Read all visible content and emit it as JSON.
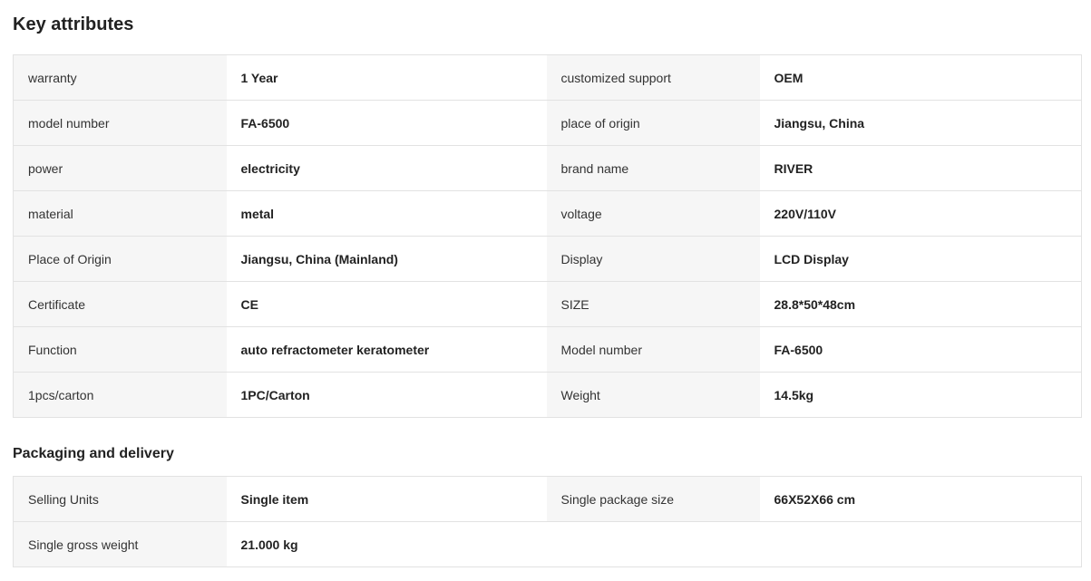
{
  "key_attributes": {
    "title": "Key attributes",
    "rows": [
      [
        {
          "label": "warranty",
          "value": "1 Year"
        },
        {
          "label": "customized support",
          "value": "OEM"
        }
      ],
      [
        {
          "label": "model number",
          "value": "FA-6500"
        },
        {
          "label": "place of origin",
          "value": "Jiangsu, China"
        }
      ],
      [
        {
          "label": "power",
          "value": "electricity"
        },
        {
          "label": "brand name",
          "value": "RIVER"
        }
      ],
      [
        {
          "label": "material",
          "value": "metal"
        },
        {
          "label": "voltage",
          "value": "220V/110V"
        }
      ],
      [
        {
          "label": "Place of Origin",
          "value": "Jiangsu, China (Mainland)"
        },
        {
          "label": "Display",
          "value": "LCD Display"
        }
      ],
      [
        {
          "label": "Certificate",
          "value": "CE"
        },
        {
          "label": "SIZE",
          "value": "28.8*50*48cm"
        }
      ],
      [
        {
          "label": "Function",
          "value": "auto refractometer keratometer"
        },
        {
          "label": "Model number",
          "value": "FA-6500"
        }
      ],
      [
        {
          "label": "1pcs/carton",
          "value": "1PC/Carton"
        },
        {
          "label": "Weight",
          "value": "14.5kg"
        }
      ]
    ]
  },
  "packaging": {
    "title": "Packaging and delivery",
    "rows": [
      [
        {
          "label": "Selling Units",
          "value": "Single item"
        },
        {
          "label": "Single package size",
          "value": "66X52X66 cm"
        }
      ],
      [
        {
          "label": "Single gross weight",
          "value": "21.000 kg"
        },
        null
      ]
    ]
  }
}
